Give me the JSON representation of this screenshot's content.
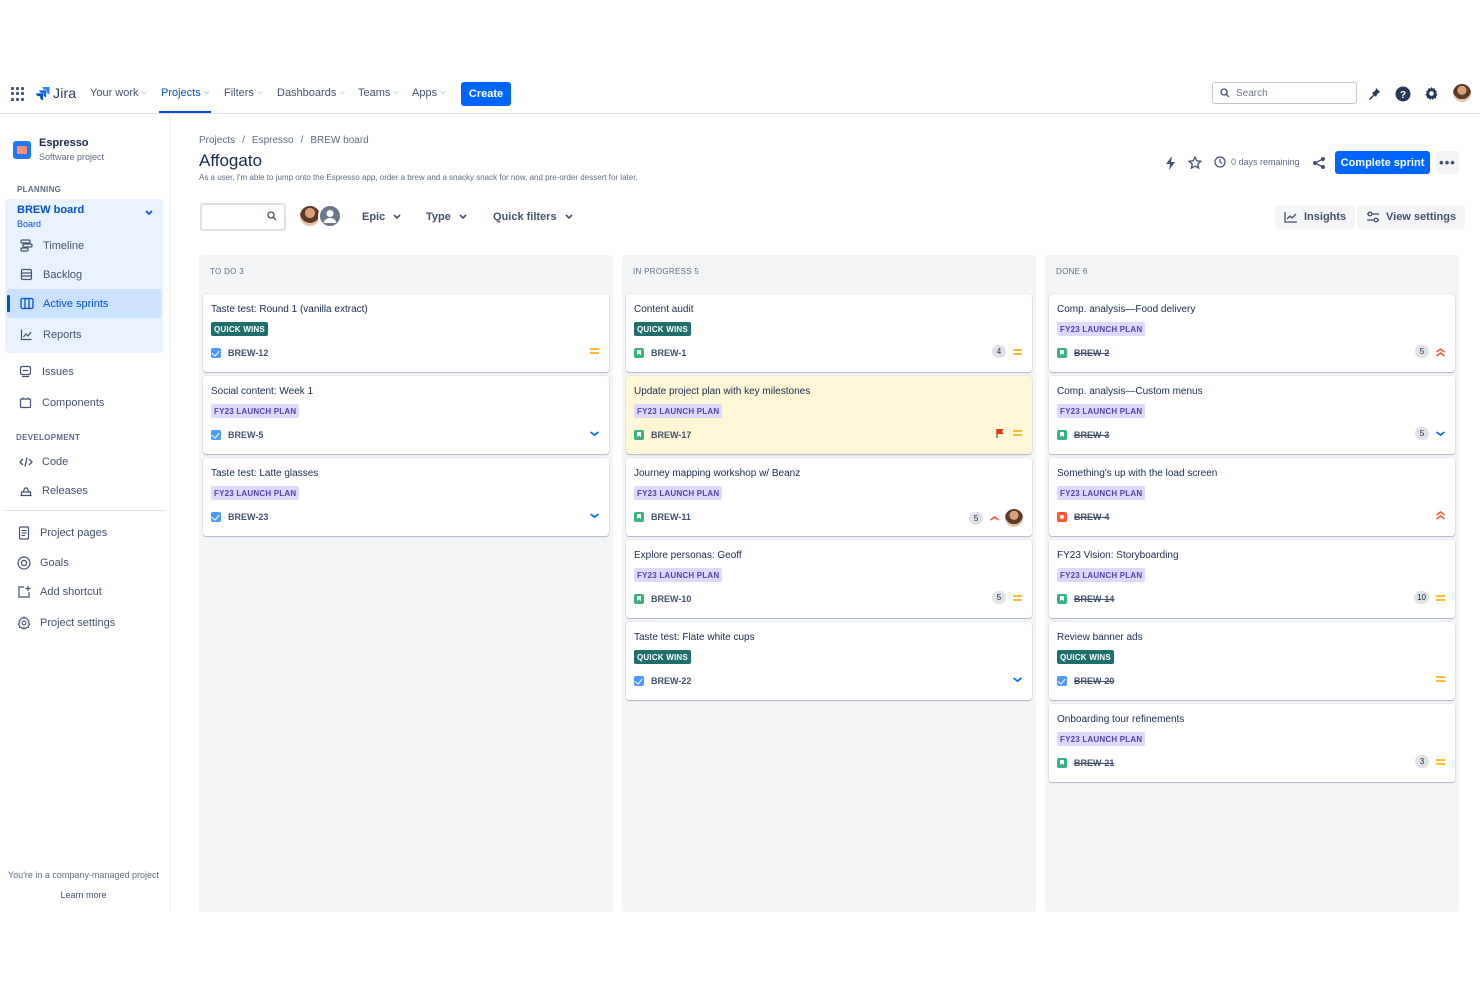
{
  "nav": {
    "logo": "Jira",
    "items": [
      {
        "label": "Your work"
      },
      {
        "label": "Projects"
      },
      {
        "label": "Filters"
      },
      {
        "label": "Dashboards"
      },
      {
        "label": "Teams"
      },
      {
        "label": "Apps"
      }
    ],
    "create_label": "Create",
    "search_placeholder": "Search"
  },
  "sidebar": {
    "project_name": "Espresso",
    "project_type": "Software project",
    "planning_label": "PLANNING",
    "board_title": "BREW board",
    "board_sub": "Board",
    "planning_items": [
      {
        "label": "Timeline",
        "icon": "timeline-icon"
      },
      {
        "label": "Backlog",
        "icon": "backlog-icon"
      },
      {
        "label": "Active sprints",
        "icon": "board-icon"
      },
      {
        "label": "Reports",
        "icon": "reports-icon"
      }
    ],
    "issues_label": "Issues",
    "components_label": "Components",
    "development_label": "DEVELOPMENT",
    "code_label": "Code",
    "releases_label": "Releases",
    "project_pages_label": "Project pages",
    "goals_label": "Goals",
    "add_shortcut_label": "Add shortcut",
    "project_settings_label": "Project settings",
    "footer_text": "You're in a company-managed project",
    "footer_link": "Learn more"
  },
  "header": {
    "breadcrumb": [
      "Projects",
      "Espresso",
      "BREW board"
    ],
    "separator": "/",
    "title": "Affogato",
    "description": "As a user, I'm able to jump onto the Espresso app, order a brew and a snacky snack for now, and pre-order dessert for later.",
    "days_remaining": "0 days remaining",
    "complete_sprint": "Complete sprint",
    "more": "•••"
  },
  "filters": {
    "epic": "Epic",
    "type": "Type",
    "quick_filters": "Quick filters",
    "insights": "Insights",
    "view_settings": "View settings"
  },
  "colors": {
    "brand_blue": "#0065FF",
    "quick_wins": "#1F6F6E",
    "fy23": "#DFD8FD",
    "highlight": "#FFF7D6"
  },
  "columns": [
    {
      "header": "TO DO 3",
      "cards": [
        {
          "title": "Taste test: Round 1 (vanilla extract)",
          "label": "QUICK WINS",
          "label_type": "quick",
          "type": "task",
          "key": "BREW-12",
          "done": false,
          "estimate": "",
          "priority": "medium",
          "avatar": false,
          "flag": false,
          "highlight": false
        },
        {
          "title": "Social content: Week 1",
          "label": "FY23 LAUNCH PLAN",
          "label_type": "fy23",
          "type": "task",
          "key": "BREW-5",
          "done": false,
          "estimate": "",
          "priority": "low",
          "avatar": false,
          "flag": false,
          "highlight": false
        },
        {
          "title": "Taste test: Latte glasses",
          "label": "FY23 LAUNCH PLAN",
          "label_type": "fy23",
          "type": "task",
          "key": "BREW-23",
          "done": false,
          "estimate": "",
          "priority": "low",
          "avatar": false,
          "flag": false,
          "highlight": false
        }
      ]
    },
    {
      "header": "IN PROGRESS 5",
      "cards": [
        {
          "title": "Content audit",
          "label": "QUICK WINS",
          "label_type": "quick",
          "type": "story",
          "key": "BREW-1",
          "done": false,
          "estimate": "4",
          "priority": "medium",
          "avatar": false,
          "flag": false,
          "highlight": false
        },
        {
          "title": "Update project plan with key milestones",
          "label": "FY23 LAUNCH PLAN",
          "label_type": "fy23",
          "type": "story",
          "key": "BREW-17",
          "done": false,
          "estimate": "",
          "priority": "medium",
          "avatar": false,
          "flag": true,
          "highlight": true
        },
        {
          "title": "Journey mapping workshop w/ Beanz",
          "label": "FY23 LAUNCH PLAN",
          "label_type": "fy23",
          "type": "story",
          "key": "BREW-11",
          "done": false,
          "estimate": "5",
          "priority": "high",
          "avatar": true,
          "flag": false,
          "highlight": false
        },
        {
          "title": "Explore personas: Geoff",
          "label": "FY23 LAUNCH PLAN",
          "label_type": "fy23",
          "type": "story",
          "key": "BREW-10",
          "done": false,
          "estimate": "5",
          "priority": "medium",
          "avatar": false,
          "flag": false,
          "highlight": false
        },
        {
          "title": "Taste test: Flate white cups",
          "label": "QUICK WINS",
          "label_type": "quick",
          "type": "task",
          "key": "BREW-22",
          "done": false,
          "estimate": "",
          "priority": "low",
          "avatar": false,
          "flag": false,
          "highlight": false
        }
      ]
    },
    {
      "header": "DONE 6",
      "cards": [
        {
          "title": "Comp. analysis—Food delivery",
          "label": "FY23 LAUNCH PLAN",
          "label_type": "fy23",
          "type": "story",
          "key": "BREW-2",
          "done": true,
          "estimate": "5",
          "priority": "highest",
          "avatar": false,
          "flag": false,
          "highlight": false
        },
        {
          "title": "Comp. analysis—Custom menus",
          "label": "FY23 LAUNCH PLAN",
          "label_type": "fy23",
          "type": "story",
          "key": "BREW-3",
          "done": true,
          "estimate": "5",
          "priority": "low",
          "avatar": false,
          "flag": false,
          "highlight": false
        },
        {
          "title": "Something's up with the load screen",
          "label": "FY23 LAUNCH PLAN",
          "label_type": "fy23",
          "type": "bug",
          "key": "BREW-4",
          "done": true,
          "estimate": "",
          "priority": "highest",
          "avatar": false,
          "flag": false,
          "highlight": false
        },
        {
          "title": "FY23 Vision: Storyboarding",
          "label": "FY23 LAUNCH PLAN",
          "label_type": "fy23",
          "type": "story",
          "key": "BREW-14",
          "done": true,
          "estimate": "10",
          "priority": "medium",
          "avatar": false,
          "flag": false,
          "highlight": false
        },
        {
          "title": "Review banner ads",
          "label": "QUICK WINS",
          "label_type": "quick",
          "type": "task",
          "key": "BREW-20",
          "done": true,
          "estimate": "",
          "priority": "medium",
          "avatar": false,
          "flag": false,
          "highlight": false
        },
        {
          "title": "Onboarding tour refinements",
          "label": "FY23 LAUNCH PLAN",
          "label_type": "fy23",
          "type": "story",
          "key": "BREW-21",
          "done": true,
          "estimate": "3",
          "priority": "medium",
          "avatar": false,
          "flag": false,
          "highlight": false
        }
      ]
    }
  ]
}
